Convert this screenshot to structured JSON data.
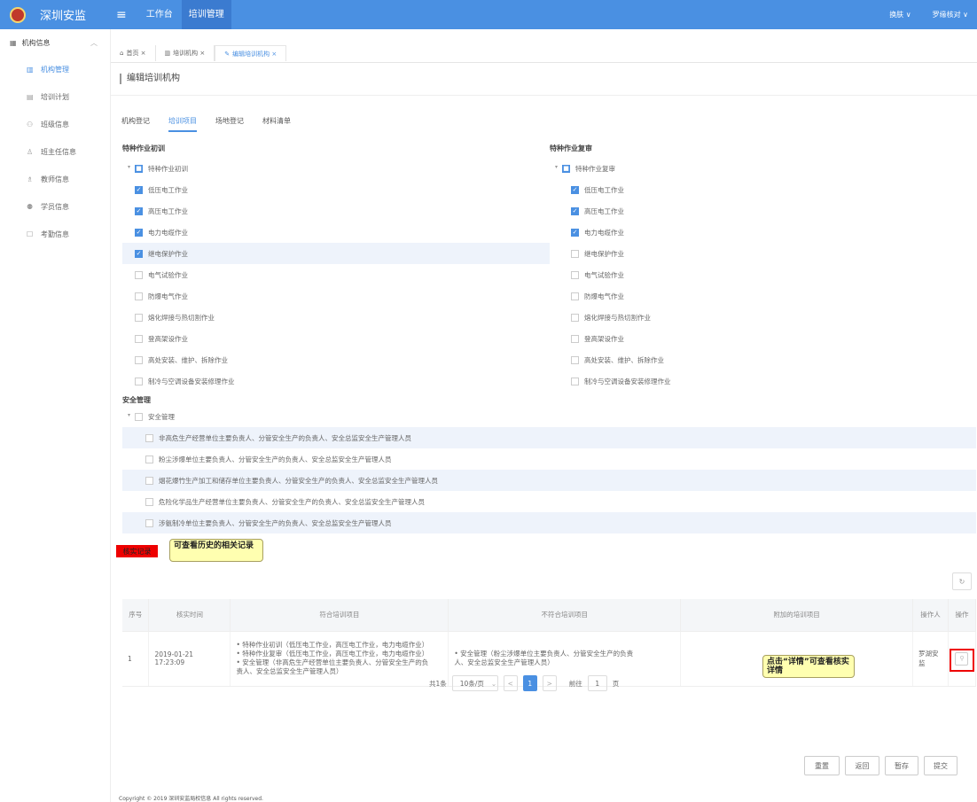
{
  "topbar": {
    "app_title": "深圳安监",
    "menu_icon": "hamburger-icon",
    "tabs": [
      "工作台",
      "培训管理"
    ],
    "right_menu": "换肤 ∨",
    "user": "罗缘核对 ∨"
  },
  "sidebar": {
    "group": "机构信息",
    "items": [
      {
        "label": "机构管理",
        "icon": "building-icon",
        "active": true
      },
      {
        "label": "培训计划",
        "icon": "calendar-icon",
        "active": false
      },
      {
        "label": "班级信息",
        "icon": "class-icon",
        "active": false
      },
      {
        "label": "班主任信息",
        "icon": "person-icon",
        "active": false
      },
      {
        "label": "教师信息",
        "icon": "teacher-icon",
        "active": false
      },
      {
        "label": "学员信息",
        "icon": "students-icon",
        "active": false
      },
      {
        "label": "考勤信息",
        "icon": "attendance-icon",
        "active": false
      }
    ]
  },
  "breadcrumbs": [
    "首页 ×",
    "培训机构 ×",
    "编辑培训机构 ×"
  ],
  "page_title": "编辑培训机构",
  "tabs": [
    "机构登记",
    "培训项目",
    "场地登记",
    "材料清单"
  ],
  "section_left": {
    "label": "特种作业初训",
    "root": "特种作业初训",
    "items": [
      {
        "label": "低压电工作业",
        "checked": true
      },
      {
        "label": "高压电工作业",
        "checked": true
      },
      {
        "label": "电力电缆作业",
        "checked": true
      },
      {
        "label": "继电保护作业",
        "checked": true
      },
      {
        "label": "电气试验作业",
        "checked": false
      },
      {
        "label": "防爆电气作业",
        "checked": false
      },
      {
        "label": "熔化焊接与热切割作业",
        "checked": false
      },
      {
        "label": "登高架设作业",
        "checked": false
      },
      {
        "label": "高处安装、维护、拆除作业",
        "checked": false
      },
      {
        "label": "制冷与空调设备安装修理作业",
        "checked": false
      }
    ]
  },
  "section_right": {
    "label": "特种作业复审",
    "root": "特种作业复审",
    "items": [
      {
        "label": "低压电工作业",
        "checked": true
      },
      {
        "label": "高压电工作业",
        "checked": true
      },
      {
        "label": "电力电缆作业",
        "checked": true
      },
      {
        "label": "继电保护作业",
        "checked": false
      },
      {
        "label": "电气试验作业",
        "checked": false
      },
      {
        "label": "防爆电气作业",
        "checked": false
      },
      {
        "label": "熔化焊接与热切割作业",
        "checked": false
      },
      {
        "label": "登高架设作业",
        "checked": false
      },
      {
        "label": "高处安装、维护、拆除作业",
        "checked": false
      },
      {
        "label": "制冷与空调设备安装修理作业",
        "checked": false
      }
    ]
  },
  "section_safety": {
    "label": "安全管理",
    "root": "安全管理",
    "items": [
      "非高危生产经营单位主要负责人、分管安全生产的负责人、安全总监安全生产管理人员",
      "粉尘涉爆单位主要负责人、分管安全生产的负责人、安全总监安全生产管理人员",
      "烟花爆竹生产加工和储存单位主要负责人、分管安全生产的负责人、安全总监安全生产管理人员",
      "危险化学品生产经营单位主要负责人、分管安全生产的负责人、安全总监安全生产管理人员",
      "涉氨制冷单位主要负责人、分管安全生产的负责人、安全总监安全生产管理人员"
    ]
  },
  "annotations": {
    "red_tag": "核实记录",
    "note_history": "可查看历史的相关记录",
    "note_detail": "点击“详情”可查看核实详情"
  },
  "table": {
    "headers": [
      "序号",
      "核实时间",
      "符合培训项目",
      "不符合培训项目",
      "附加的培训项目",
      "操作人",
      "操作"
    ],
    "rows": [
      {
        "index": "1",
        "time": "2019-01-21 17:23:09",
        "ok": [
          "• 特种作业初训（低压电工作业，高压电工作业，电力电缆作业）",
          "• 特种作业复审（低压电工作业，高压电工作业，电力电缆作业）",
          "• 安全管理（非高危生产经营单位主要负责人、分管安全生产的负",
          "  责人、安全总监安全生产管理人员）"
        ],
        "not_ok": [
          "• 安全管理（粉尘涉爆单位主要负责人、分管安全生产的负责",
          "  人、安全总监安全生产管理人员）"
        ],
        "extra": "",
        "operator": "罗湖安监"
      }
    ]
  },
  "pager": {
    "total": "共1条",
    "size": "10条/页",
    "prev": "<",
    "current": "1",
    "next": ">",
    "goto_label": "前往",
    "goto_value": "1",
    "page_suffix": "页"
  },
  "footer_buttons": [
    "重置",
    "返回",
    "暂存",
    "提交"
  ],
  "copyright": "Copyright © 2019 深圳安监局权信息 All rights reserved."
}
